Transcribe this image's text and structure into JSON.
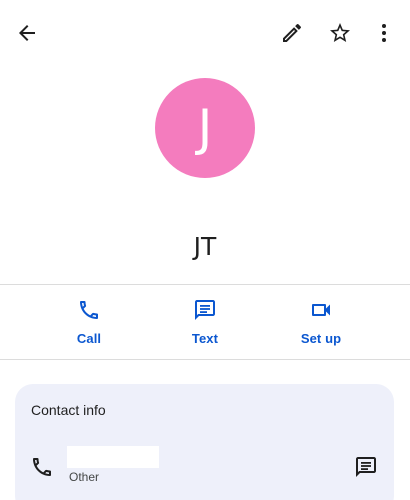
{
  "contact": {
    "initial": "J",
    "name": "JT"
  },
  "actions": {
    "call_label": "Call",
    "text_label": "Text",
    "setup_label": "Set up"
  },
  "contact_info": {
    "title": "Contact info",
    "phone_type": "Other"
  },
  "icons": {
    "back": "arrow-back-icon",
    "edit": "pencil-icon",
    "favorite": "star-outline-icon",
    "more": "more-vert-icon",
    "call": "phone-icon",
    "text": "message-icon",
    "setup": "video-icon"
  },
  "colors": {
    "avatar": "#f47cbe",
    "accent": "#0b57d0",
    "card_background": "#eef0fa"
  }
}
